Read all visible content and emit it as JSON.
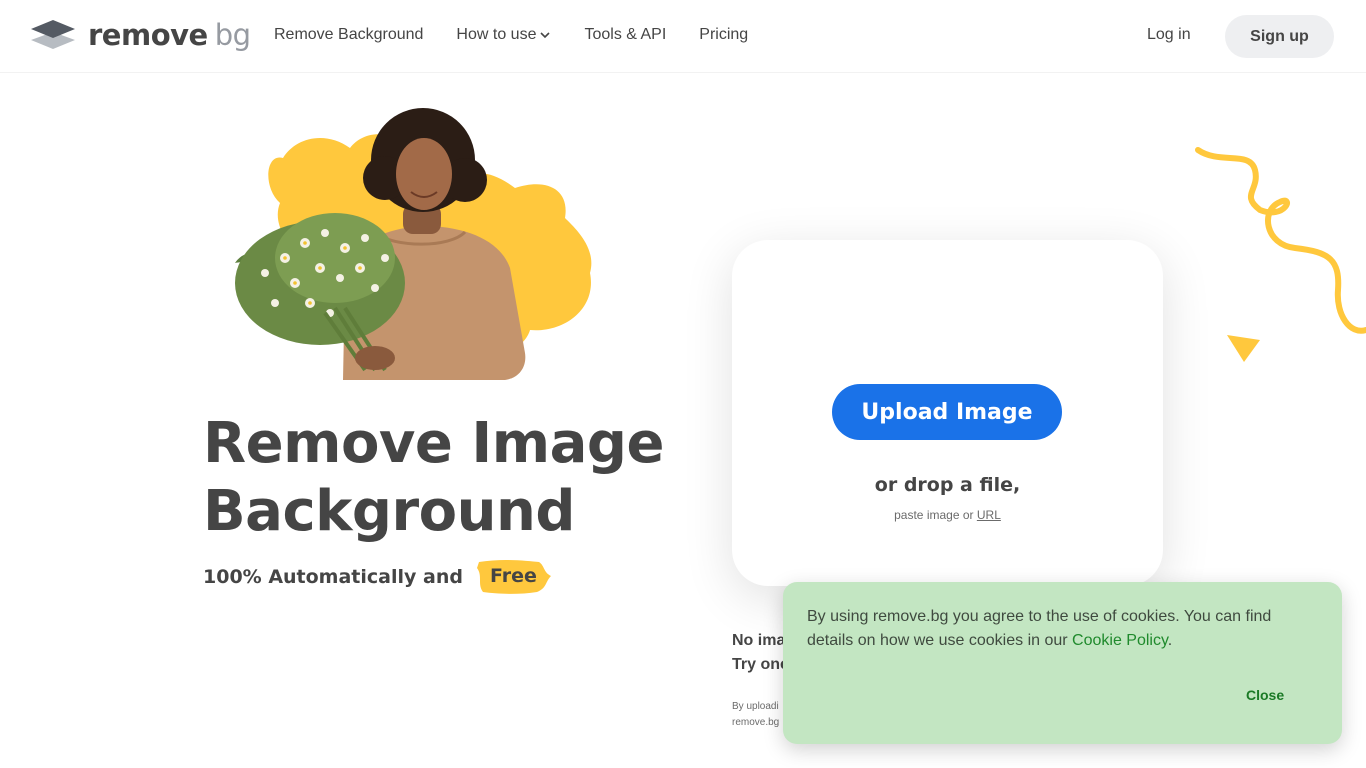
{
  "header": {
    "logo_text": "remove",
    "logo_text_suffix": "bg",
    "nav": [
      {
        "label": "Remove Background"
      },
      {
        "label": "How to use"
      },
      {
        "label": "Tools & API"
      },
      {
        "label": "Pricing"
      }
    ],
    "login_label": "Log in",
    "signup_label": "Sign up"
  },
  "hero": {
    "title_line1": "Remove Image",
    "title_line2": "Background",
    "subtitle": "100% Automatically and",
    "highlight": "Free"
  },
  "upload": {
    "button_label": "Upload Image",
    "drop_text": "or drop a file,",
    "paste_text": "paste image or",
    "url_link": "URL"
  },
  "below": {
    "line1": "No ima",
    "line2": "Try one",
    "terms1": "By uploadi",
    "terms2": "remove.bg"
  },
  "cookie": {
    "text": "By using remove.bg you agree to the use of cookies. You can find details on how we use cookies in our",
    "link": "Cookie Policy",
    "period": ".",
    "close_label": "Close"
  },
  "colors": {
    "primary_blue": "#1a72e8",
    "accent_yellow": "#ffc83d",
    "cookie_green": "#c3e6c2",
    "text_dark": "#454545"
  },
  "icons": {
    "logo": "layers-logo-icon",
    "dropdown": "chevron-down-icon"
  }
}
